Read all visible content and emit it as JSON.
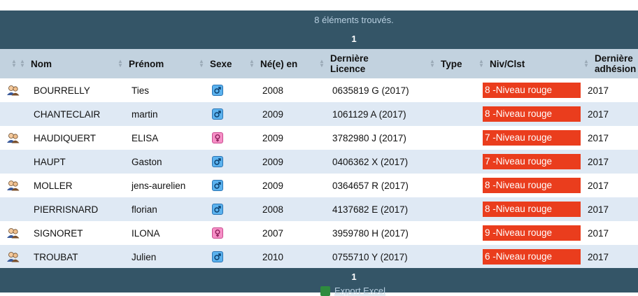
{
  "summary": {
    "found_text": "8 éléments trouvés.",
    "page_top": "1",
    "page_bottom": "1",
    "export_label": "Export Excel"
  },
  "columns": [
    {
      "key": "icon",
      "label": ""
    },
    {
      "key": "nom",
      "label": "Nom"
    },
    {
      "key": "prenom",
      "label": "Prénom"
    },
    {
      "key": "sexe",
      "label": "Sexe"
    },
    {
      "key": "ne_en",
      "label": "Né(e) en"
    },
    {
      "key": "licence",
      "label": "Dernière Licence"
    },
    {
      "key": "type",
      "label": "Type"
    },
    {
      "key": "niv",
      "label": "Niv/Clst"
    },
    {
      "key": "adhesion",
      "label": "Dernière adhésion"
    }
  ],
  "rows": [
    {
      "avatar": true,
      "nom": "BOURRELLY",
      "prenom": "Ties",
      "sexe": "M",
      "ne_en": "2008",
      "licence": "0635819 G (2017)",
      "type": "",
      "niv": "8 -Niveau rouge",
      "adhesion": "2017"
    },
    {
      "avatar": false,
      "nom": "CHANTECLAIR",
      "prenom": "martin",
      "sexe": "M",
      "ne_en": "2009",
      "licence": "1061129 A (2017)",
      "type": "",
      "niv": "8 -Niveau rouge",
      "adhesion": "2017"
    },
    {
      "avatar": true,
      "nom": "HAUDIQUERT",
      "prenom": "ELISA",
      "sexe": "F",
      "ne_en": "2009",
      "licence": "3782980 J (2017)",
      "type": "",
      "niv": "7 -Niveau rouge",
      "adhesion": "2017"
    },
    {
      "avatar": false,
      "nom": "HAUPT",
      "prenom": "Gaston",
      "sexe": "M",
      "ne_en": "2009",
      "licence": "0406362 X (2017)",
      "type": "",
      "niv": "7 -Niveau rouge",
      "adhesion": "2017"
    },
    {
      "avatar": true,
      "nom": "MOLLER",
      "prenom": "jens-aurelien",
      "sexe": "M",
      "ne_en": "2009",
      "licence": "0364657 R (2017)",
      "type": "",
      "niv": "8 -Niveau rouge",
      "adhesion": "2017"
    },
    {
      "avatar": false,
      "nom": "PIERRISNARD",
      "prenom": "florian",
      "sexe": "M",
      "ne_en": "2008",
      "licence": "4137682 E (2017)",
      "type": "",
      "niv": "8 -Niveau rouge",
      "adhesion": "2017"
    },
    {
      "avatar": true,
      "nom": "SIGNORET",
      "prenom": "ILONA",
      "sexe": "F",
      "ne_en": "2007",
      "licence": "3959780 H (2017)",
      "type": "",
      "niv": "9 -Niveau rouge",
      "adhesion": "2017"
    },
    {
      "avatar": true,
      "nom": "TROUBAT",
      "prenom": "Julien",
      "sexe": "M",
      "ne_en": "2010",
      "licence": "0755710 Y (2017)",
      "type": "",
      "niv": "6 -Niveau rouge",
      "adhesion": "2017"
    }
  ],
  "colors": {
    "header_bar": "#345567",
    "column_header": "#c2d2df",
    "row_even": "#dfe9f4",
    "badge_red": "#ea3d1d",
    "male_icon": "#5bb2ee",
    "female_icon": "#f68fc6"
  },
  "icons": {
    "avatar": "users-icon",
    "male": "male-symbol-icon",
    "female": "female-symbol-icon",
    "sort": "sort-icon",
    "export": "excel-icon"
  }
}
